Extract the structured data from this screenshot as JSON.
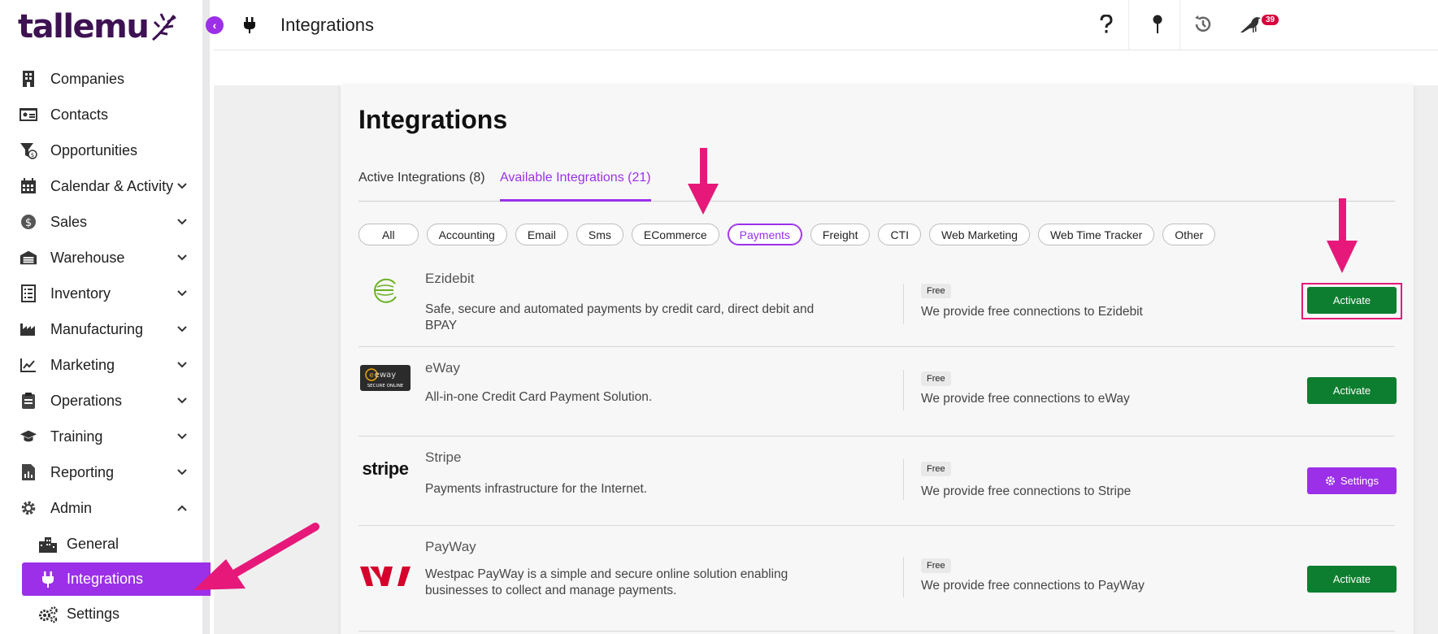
{
  "brand": {
    "logo_text": "tallemu"
  },
  "header": {
    "title": "Integrations",
    "notification_count": "39"
  },
  "sidebar": {
    "items": [
      {
        "label": "Companies",
        "icon": "building-icon",
        "expandable": false
      },
      {
        "label": "Contacts",
        "icon": "contact-card-icon",
        "expandable": false
      },
      {
        "label": "Opportunities",
        "icon": "funnel-icon",
        "expandable": false
      },
      {
        "label": "Calendar & Activity",
        "icon": "calendar-icon",
        "expandable": true
      },
      {
        "label": "Sales",
        "icon": "dollar-icon",
        "expandable": true
      },
      {
        "label": "Warehouse",
        "icon": "warehouse-icon",
        "expandable": true
      },
      {
        "label": "Inventory",
        "icon": "inventory-icon",
        "expandable": true
      },
      {
        "label": "Manufacturing",
        "icon": "factory-icon",
        "expandable": true
      },
      {
        "label": "Marketing",
        "icon": "chart-line-icon",
        "expandable": true
      },
      {
        "label": "Operations",
        "icon": "clipboard-icon",
        "expandable": true
      },
      {
        "label": "Training",
        "icon": "graduation-cap-icon",
        "expandable": true
      },
      {
        "label": "Reporting",
        "icon": "report-icon",
        "expandable": true
      },
      {
        "label": "Admin",
        "icon": "gear-icon",
        "expandable": true,
        "expanded": true
      }
    ],
    "admin_sub": [
      {
        "label": "General",
        "icon": "city-icon"
      },
      {
        "label": "Integrations",
        "icon": "plug-icon",
        "active": true
      },
      {
        "label": "Settings",
        "icon": "gears-icon"
      }
    ]
  },
  "page": {
    "title": "Integrations",
    "tabs": [
      {
        "label": "Active Integrations (8)",
        "active": false
      },
      {
        "label": "Available Integrations (21)",
        "active": true
      }
    ],
    "filters": [
      "All",
      "Accounting",
      "Email",
      "Sms",
      "ECommerce",
      "Payments",
      "Freight",
      "CTI",
      "Web Marketing",
      "Web Time Tracker",
      "Other"
    ],
    "active_filter": "Payments",
    "integrations": [
      {
        "name": "Ezidebit",
        "description": "Safe, secure and automated payments by credit card, direct debit and BPAY",
        "price": "Free",
        "connection": "We provide free connections to Ezidebit",
        "action": "Activate"
      },
      {
        "name": "eWay",
        "description": "All-in-one Credit Card Payment Solution.",
        "price": "Free",
        "connection": "We provide free connections to eWay",
        "action": "Activate",
        "logo_text": "eway",
        "logo_sub": "SECURE ONLINE"
      },
      {
        "name": "Stripe",
        "description": "Payments infrastructure for the Internet.",
        "price": "Free",
        "connection": "We provide free connections to Stripe",
        "action": "Settings",
        "logo_text": "stripe"
      },
      {
        "name": "PayWay",
        "description": "Westpac PayWay is a simple and secure online solution enabling businesses to collect and manage payments.",
        "price": "Free",
        "connection": "We provide free connections to PayWay",
        "action": "Activate"
      }
    ]
  },
  "colors": {
    "accent": "#9b30e8",
    "activate": "#0d7e2f",
    "annotation": "#e6197a"
  }
}
